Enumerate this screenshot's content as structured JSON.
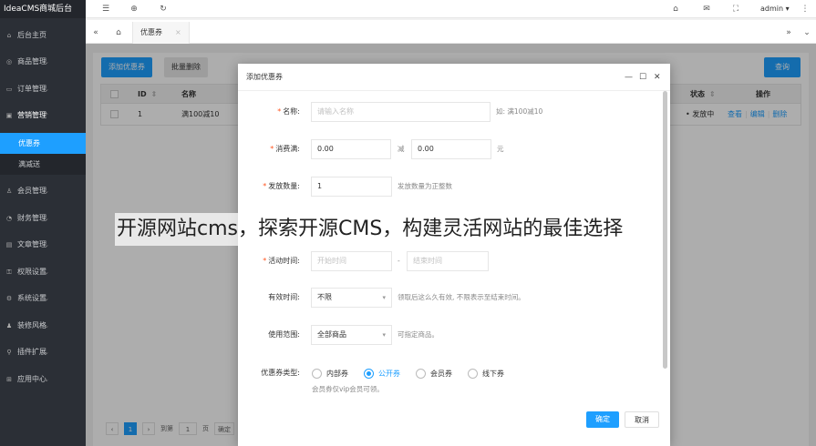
{
  "sidebar": {
    "logo": "IdeaCMS商城后台",
    "items": [
      {
        "label": "后台主页",
        "icon": "home-icon"
      },
      {
        "label": "商品管理",
        "icon": "goods-icon"
      },
      {
        "label": "订单管理",
        "icon": "order-icon"
      },
      {
        "label": "营销管理",
        "icon": "marketing-icon"
      },
      {
        "label": "会员管理",
        "icon": "user-icon"
      },
      {
        "label": "财务管理",
        "icon": "finance-icon"
      },
      {
        "label": "文章管理",
        "icon": "article-icon"
      },
      {
        "label": "权限设置",
        "icon": "permission-icon"
      },
      {
        "label": "系统设置",
        "icon": "settings-icon"
      },
      {
        "label": "装修风格",
        "icon": "theme-icon"
      },
      {
        "label": "插件扩展",
        "icon": "plugin-icon"
      },
      {
        "label": "应用中心",
        "icon": "app-icon"
      }
    ],
    "sub_items": [
      "优惠券",
      "满减送"
    ]
  },
  "topbar": {
    "user": "admin ▾"
  },
  "tabs": {
    "active": "优惠券",
    "close": "×"
  },
  "toolbar": {
    "add": "添加优惠券",
    "batch_delete": "批量删除",
    "search": "查询"
  },
  "table": {
    "headers": [
      "ID",
      "名称",
      "状态",
      "操作"
    ],
    "rows": [
      {
        "id": "1",
        "name": "满100减10",
        "status": "• 发放中",
        "actions": [
          "查看",
          "编辑",
          "删除"
        ]
      }
    ]
  },
  "pager": {
    "page": "1",
    "goto": "到第",
    "page_input": "1",
    "unit": "页",
    "confirm": "确定"
  },
  "modal": {
    "title": "添加优惠券",
    "fields": {
      "name": {
        "label": "名称:",
        "placeholder": "请输入名称",
        "hint": "如: 满100减10",
        "required": true
      },
      "threshold": {
        "label": "消费满:",
        "value": "0.00",
        "minus": "减",
        "value2": "0.00",
        "unit": "元",
        "required": true
      },
      "quantity": {
        "label": "发放数量:",
        "value": "1",
        "hint": "发放数量为正整数",
        "required": true
      },
      "time": {
        "label": "活动时间:",
        "start": "开始时间",
        "dash": "-",
        "end": "结束时间",
        "required": true
      },
      "validity": {
        "label": "有效时间:",
        "value": "不限",
        "hint": "领取后这么久有效, 不限表示至结束时间。"
      },
      "scope": {
        "label": "使用范围:",
        "value": "全部商品",
        "hint": "可指定商品。"
      },
      "type": {
        "label": "优惠券类型:",
        "options": [
          "内部券",
          "公开券",
          "会员券",
          "线下券"
        ],
        "selected": 1,
        "note": "会员券仅vip会员可领。"
      }
    },
    "ok": "确定",
    "cancel": "取消"
  },
  "watermark": "开源网站cms，探索开源CMS，构建灵活网站的最佳选择"
}
